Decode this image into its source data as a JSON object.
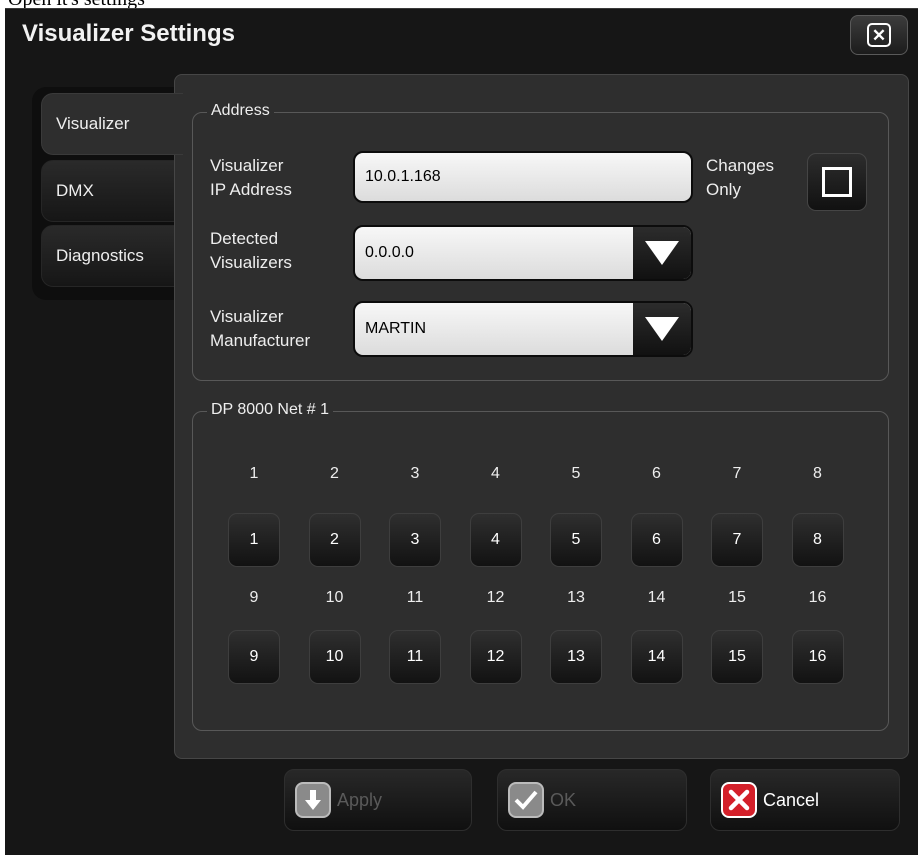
{
  "caption": "Open it's settings",
  "dialog": {
    "title": "Visualizer Settings",
    "close_icon": "close-x-icon"
  },
  "tabs": [
    {
      "label": "Visualizer",
      "active": true
    },
    {
      "label": "DMX",
      "active": false
    },
    {
      "label": "Diagnostics",
      "active": false
    }
  ],
  "address": {
    "legend": "Address",
    "ip_label_1": "Visualizer",
    "ip_label_2": "IP Address",
    "ip_value": "10.0.1.168",
    "changes_label_1": "Changes",
    "changes_label_2": "Only",
    "changes_only_checked": false,
    "detected_label_1": "Detected",
    "detected_label_2": "Visualizers",
    "detected_value": "0.0.0.0",
    "manufacturer_label_1": "Visualizer",
    "manufacturer_label_2": "Manufacturer",
    "manufacturer_value": "MARTIN"
  },
  "net": {
    "legend": "DP 8000 Net # 1",
    "labels": [
      "1",
      "2",
      "3",
      "4",
      "5",
      "6",
      "7",
      "8",
      "9",
      "10",
      "11",
      "12",
      "13",
      "14",
      "15",
      "16"
    ],
    "buttons": [
      "1",
      "2",
      "3",
      "4",
      "5",
      "6",
      "7",
      "8",
      "9",
      "10",
      "11",
      "12",
      "13",
      "14",
      "15",
      "16"
    ]
  },
  "actions": {
    "apply": "Apply",
    "ok": "OK",
    "cancel": "Cancel",
    "apply_icon": "download-arrow-icon",
    "ok_icon": "checkmark-icon",
    "cancel_icon": "x-icon",
    "cancel_color": "#d4202a"
  }
}
